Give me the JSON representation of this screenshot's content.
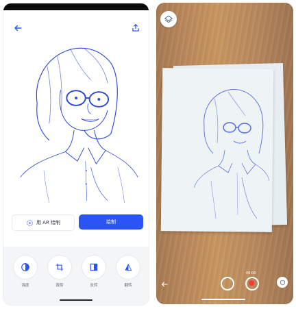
{
  "left_phone": {
    "buttons": {
      "ar_label": "用 AR 绘制",
      "primary_label": "绘制"
    },
    "tools": [
      {
        "label": "强度",
        "icon": "contrast-icon"
      },
      {
        "label": "裁剪",
        "icon": "crop-icon"
      },
      {
        "label": "反转",
        "icon": "invert-icon"
      },
      {
        "label": "翻转",
        "icon": "flip-icon"
      }
    ]
  },
  "right_phone": {
    "timer": "00:00"
  },
  "colors": {
    "primary": "#2b54f5",
    "sketch": "#2f49d8",
    "record": "#ff3a30"
  }
}
